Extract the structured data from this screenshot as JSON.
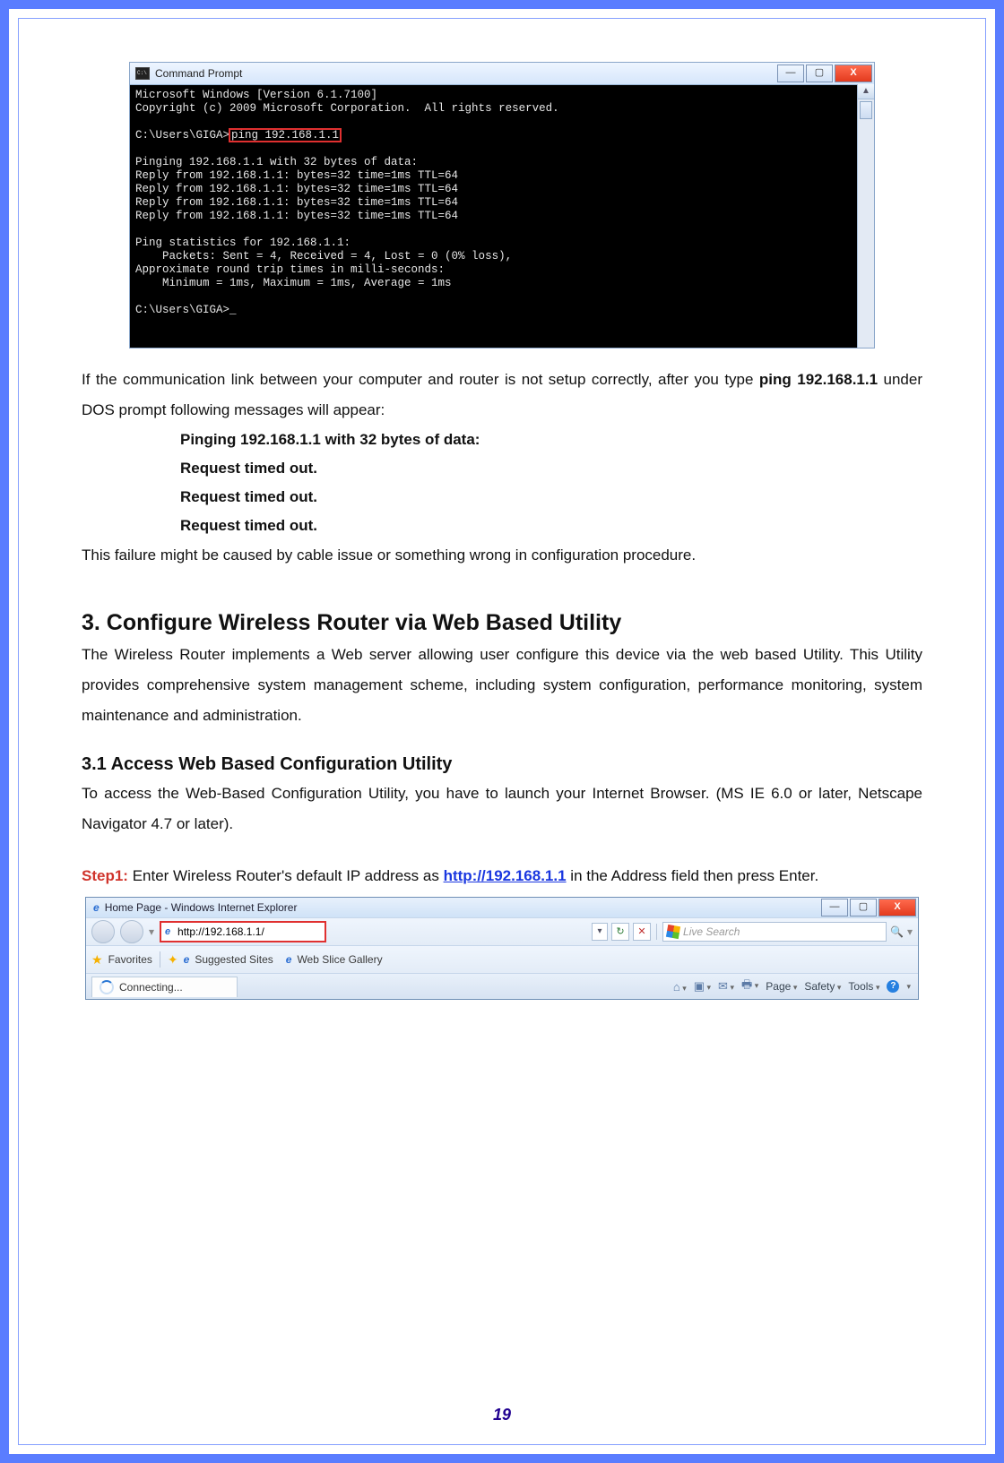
{
  "cmd": {
    "title": "Command Prompt",
    "minimize": "—",
    "maximize": "▢",
    "close": "X",
    "lines": {
      "l1": "Microsoft Windows [Version 6.1.7100]",
      "l2": "Copyright (c) 2009 Microsoft Corporation.  All rights reserved.",
      "l3a": "C:\\Users\\GIGA>",
      "l3b": "ping 192.168.1.1",
      "l4": "Pinging 192.168.1.1 with 32 bytes of data:",
      "l5": "Reply from 192.168.1.1: bytes=32 time=1ms TTL=64",
      "l6": "Reply from 192.168.1.1: bytes=32 time=1ms TTL=64",
      "l7": "Reply from 192.168.1.1: bytes=32 time=1ms TTL=64",
      "l8": "Reply from 192.168.1.1: bytes=32 time=1ms TTL=64",
      "l9": "Ping statistics for 192.168.1.1:",
      "l10": "    Packets: Sent = 4, Received = 4, Lost = 0 (0% loss),",
      "l11": "Approximate round trip times in milli-seconds:",
      "l12": "    Minimum = 1ms, Maximum = 1ms, Average = 1ms",
      "l13": "C:\\Users\\GIGA>_"
    }
  },
  "doc": {
    "p1a": "If the communication link between your computer and router is not setup correctly, after you type ",
    "p1b": "ping 192.168.1.1",
    "p1c": " under DOS prompt following messages will appear:",
    "i1": "Pinging 192.168.1.1 with 32 bytes of data:",
    "i2": "Request timed out.",
    "i3": "Request timed out.",
    "i4": "Request timed out.",
    "p2": "This failure might be caused by cable issue or something wrong in configuration procedure.",
    "h2": "3. Configure Wireless Router via Web Based Utility",
    "p3": "The Wireless Router implements a Web server allowing user configure this device via the web based Utility. This Utility provides comprehensive system management scheme, including system configuration, performance monitoring, system maintenance and administration.",
    "h3": "3.1 Access Web Based Configuration Utility",
    "p4": "To access the Web-Based Configuration Utility, you have to launch your Internet Browser. (MS IE 6.0 or later, Netscape Navigator 4.7 or later).",
    "step_label": "Step1:",
    "p5a": " Enter Wireless Router's default IP address as ",
    "link": "http://192.168.1.1",
    "p5b": " in the Address field then press Enter."
  },
  "ie": {
    "title": "Home Page - Windows Internet Explorer",
    "minimize": "—",
    "maximize": "▢",
    "close": "X",
    "address": "http://192.168.1.1/",
    "refresh": "↻",
    "stop": "✕",
    "search_placeholder": "Live Search",
    "search_icon": "🔍",
    "favorites": "Favorites",
    "suggested": "Suggested Sites",
    "webslice": "Web Slice Gallery",
    "tab": "Connecting...",
    "page": "Page",
    "safety": "Safety",
    "tools": "Tools",
    "home_ico": "⌂",
    "rss_ico": "▣",
    "mail_ico": "✉",
    "print_ico": "🖶",
    "help": "?"
  },
  "page_number": "19"
}
